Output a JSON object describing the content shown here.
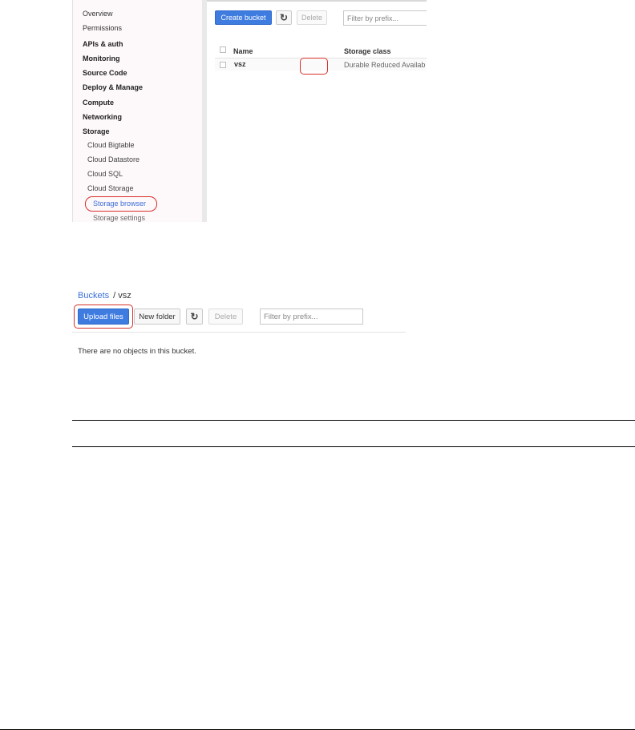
{
  "console_sidebar": {
    "items": [
      {
        "label": "Overview"
      },
      {
        "label": "Permissions"
      },
      {
        "label": "APIs & auth"
      },
      {
        "label": "Monitoring"
      },
      {
        "label": "Source Code"
      },
      {
        "label": "Deploy & Manage"
      },
      {
        "label": "Compute"
      },
      {
        "label": "Networking"
      },
      {
        "label": "Storage"
      },
      {
        "label": "Cloud Bigtable"
      },
      {
        "label": "Cloud Datastore"
      },
      {
        "label": "Cloud SQL"
      },
      {
        "label": "Cloud Storage"
      },
      {
        "label": "Storage browser"
      },
      {
        "label": "Storage settings"
      }
    ]
  },
  "bucket_list": {
    "toolbar": {
      "create_label": "Create bucket",
      "refresh_icon": "refresh-icon",
      "delete_label": "Delete",
      "filter_placeholder": "Filter by prefix..."
    },
    "columns": [
      "Name",
      "Storage class"
    ],
    "rows": [
      {
        "name": "vsz",
        "storage_class": "Durable Reduced Availab"
      }
    ]
  },
  "bucket_detail": {
    "breadcrumb": {
      "root": "Buckets",
      "separator": "/",
      "current": "vsz"
    },
    "toolbar": {
      "upload_label": "Upload files",
      "new_folder_label": "New folder",
      "refresh_icon": "refresh-icon",
      "delete_label": "Delete",
      "filter_placeholder": "Filter by prefix..."
    },
    "empty_message": "There are no objects in this bucket."
  },
  "colors": {
    "primary": "#3f7ce0",
    "link": "#3b6fd8",
    "highlight": "#d9302b"
  }
}
